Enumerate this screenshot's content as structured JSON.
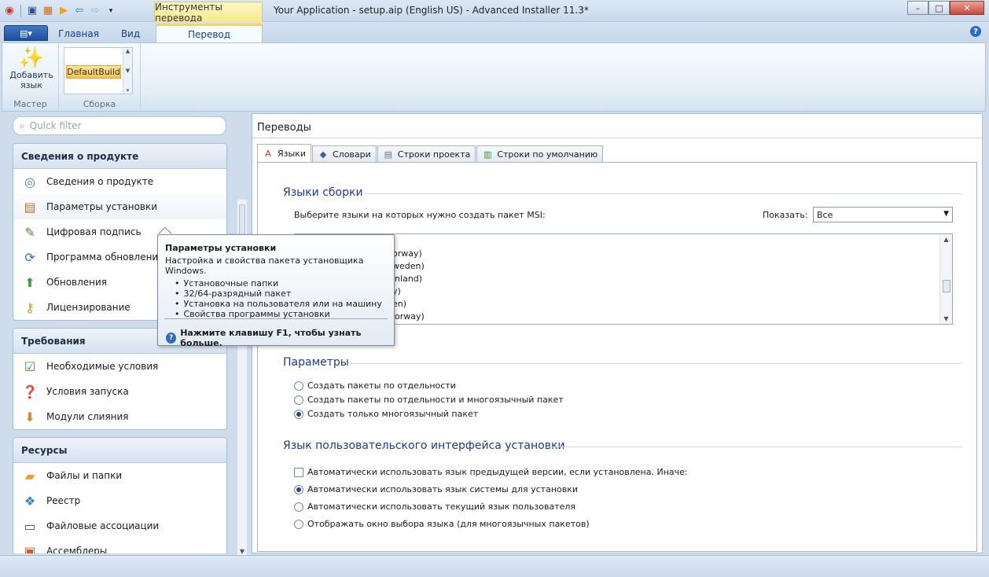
{
  "window": {
    "title": "Your Application - setup.aip (English US) - Advanced Installer 11.3*",
    "context_tab_title": "Инструменты перевода",
    "controls": {
      "minimize": "–",
      "maximize": "□",
      "close": "✕"
    }
  },
  "quick_access": {
    "icons": [
      "app-icon",
      "save-icon",
      "build-icon",
      "run-icon",
      "back-icon",
      "forward-icon",
      "customize-icon"
    ]
  },
  "ribbon": {
    "app_menu": "▤▾",
    "tabs": [
      {
        "label": "Главная"
      },
      {
        "label": "Вид"
      },
      {
        "label": "Перевод",
        "active": true
      }
    ],
    "groups": {
      "wizard": {
        "label": "Мастер",
        "add_language": "Добавить язык"
      },
      "build": {
        "label": "Сборка",
        "selected": "DefaultBuild"
      }
    },
    "help": "?"
  },
  "left": {
    "quick_filter_placeholder": "Quick filter",
    "sections": [
      {
        "title": "Сведения о продукте",
        "items": [
          {
            "label": "Сведения о продукте",
            "icon": "product-details-icon"
          },
          {
            "label": "Параметры установки",
            "icon": "install-parameters-icon"
          },
          {
            "label": "Цифровая подпись",
            "icon": "digital-signature-icon"
          },
          {
            "label": "Программа обновления",
            "icon": "updater-icon"
          },
          {
            "label": "Обновления",
            "icon": "upgrades-icon"
          },
          {
            "label": "Лицензирование",
            "icon": "licensing-icon"
          }
        ]
      },
      {
        "title": "Требования",
        "items": [
          {
            "label": "Необходимые условия",
            "icon": "prerequisites-icon"
          },
          {
            "label": "Условия запуска",
            "icon": "launch-conditions-icon"
          },
          {
            "label": "Модули слияния",
            "icon": "merge-modules-icon"
          }
        ]
      },
      {
        "title": "Ресурсы",
        "items": [
          {
            "label": "Файлы и папки",
            "icon": "files-folders-icon"
          },
          {
            "label": "Реестр",
            "icon": "registry-icon"
          },
          {
            "label": "Файловые ассоциации",
            "icon": "file-associations-icon"
          },
          {
            "label": "Ассемблеры",
            "icon": "assemblies-icon"
          }
        ]
      }
    ]
  },
  "main": {
    "title": "Переводы",
    "tabs": [
      {
        "label": "Языки",
        "active": true
      },
      {
        "label": "Словари"
      },
      {
        "label": "Строки проекта"
      },
      {
        "label": "Строки по умолчанию"
      }
    ],
    "build_languages": {
      "title": "Языки сборки",
      "prompt": "Выберите языки на которых нужно создать пакет MSI:",
      "show_label": "Показать:",
      "show_value": "Все",
      "list_visible_fragments": [
        "orway)",
        "weden)",
        "inland)",
        "y)",
        "en)",
        "lorway)"
      ]
    },
    "parameters": {
      "title": "Параметры",
      "options": [
        {
          "label": "Создать пакеты по отдельности",
          "checked": false
        },
        {
          "label": "Создать пакеты по отдельности и многоязычный пакет",
          "checked": false
        },
        {
          "label": "Создать только многоязычный пакет",
          "checked": true
        }
      ]
    },
    "ui_language": {
      "title": "Язык пользовательского интерфейса установки",
      "checkbox": {
        "label": "Автоматически использовать язык предыдущей версии, если установлена. Иначе:",
        "checked": false
      },
      "options": [
        {
          "label": "Автоматически использовать язык системы для установки",
          "checked": true
        },
        {
          "label": "Автоматически использовать текущий язык пользователя",
          "checked": false
        },
        {
          "label": "Отображать окно выбора языка (для многоязычных пакетов)",
          "checked": false
        }
      ]
    }
  },
  "tooltip": {
    "title": "Параметры установки",
    "description": "Настройка и свойства пакета установщика Windows.",
    "bullets": [
      "Установочные папки",
      "32/64-разрядный пакет",
      "Установка на пользователя или на машину",
      "Свойства программы установки"
    ],
    "footer": "Нажмите клавишу F1, чтобы узнать больше."
  },
  "colors": {
    "accent": "#1f3a8f",
    "ribbon_tab_text": "#15428b",
    "context_tab": "#f5e98d"
  }
}
